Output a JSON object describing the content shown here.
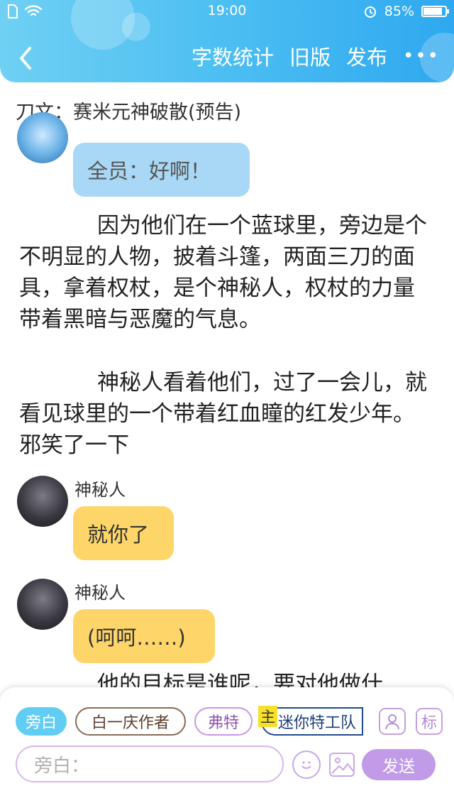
{
  "status_bar": {
    "time": "19:00",
    "battery": "85%",
    "sim_icon": "sim-icon",
    "wifi_icon": "wifi-icon",
    "alarm_icon": "alarm-icon"
  },
  "nav": {
    "back_icon": "chevron-left-icon",
    "word_count": "字数统计",
    "old_version": "旧版",
    "publish": "发布",
    "more": "•••"
  },
  "title": "刀文：赛米元神破散(预告)",
  "messages": [
    {
      "speaker": "",
      "text": "全员：好啊！",
      "bubble_color": "#a8d8f5"
    },
    {
      "speaker": "神秘人",
      "text": "就你了",
      "bubble_color": "#fdd568"
    },
    {
      "speaker": "神秘人",
      "text": "(呵呵……)",
      "bubble_color": "#fdd568"
    }
  ],
  "paragraphs": [
    "因为他们在一个蓝球里，旁边是个不明显的人物，披着斗篷，两面三刀的面具，拿着权杖，是个神秘人，权杖的力量带着黑暗与恶魔的气息。",
    "神秘人看着他们，过了一会儿，就看见球里的一个带着红血瞳的红发少年。邪笑了一下",
    "他的目标是谁呢，要对他做什"
  ],
  "composer": {
    "chips": [
      "旁白",
      "白一庆作者",
      "弗特",
      "迷你特工队"
    ],
    "main_tag": "主",
    "input_placeholder": "旁白：",
    "send_label": "发送",
    "mark_label": "标",
    "colors": {
      "active_chip": "#62cdf3",
      "send_button": "#c19be8"
    }
  }
}
